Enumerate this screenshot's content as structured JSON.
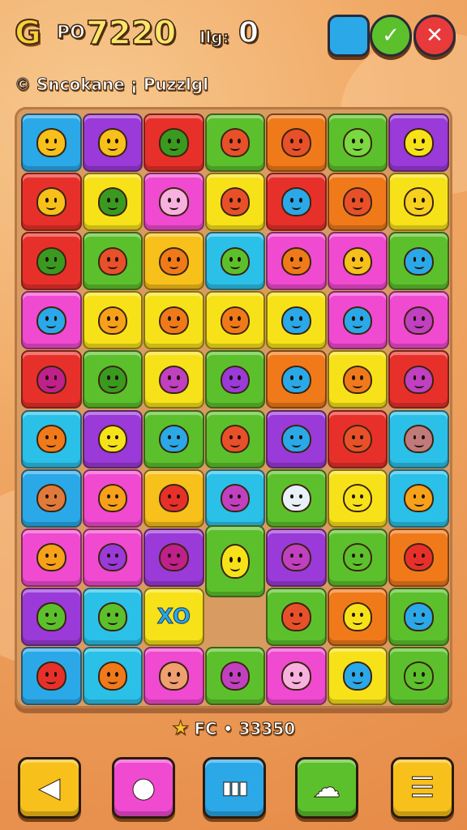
{
  "hud": {
    "logo": "G",
    "score_prefix": "PO",
    "score_value": "7220",
    "moves_label": "Ilg:",
    "moves_value": "0"
  },
  "top_buttons": [
    {
      "name": "menu-square-button",
      "color": "#2aa8e8",
      "shape": "square",
      "glyph": ""
    },
    {
      "name": "check-button",
      "color": "#5cc02c",
      "shape": "round",
      "glyph": "✓"
    },
    {
      "name": "close-button",
      "color": "#e83a3a",
      "shape": "round",
      "glyph": "✕"
    }
  ],
  "subtitle": "© Sncokane ¡ Puzzlgl",
  "board": {
    "rows": 10,
    "cols": 7,
    "colors": [
      [
        "#2aa8e8",
        "#9a3ad8",
        "#e8302a",
        "#5cc02c",
        "#f07a1a",
        "#5cc02c",
        "#9a3ad8"
      ],
      [
        "#e8302a",
        "#f7e21a",
        "#f04ad0",
        "#f7e21a",
        "#e8302a",
        "#f07a1a",
        "#f7e21a"
      ],
      [
        "#e8302a",
        "#5cc02c",
        "#f7c01a",
        "#2ac0e8",
        "#f04ad0",
        "#f04ad0",
        "#5cc02c"
      ],
      [
        "#f04ad0",
        "#f7e21a",
        "#f7e21a",
        "#f7e21a",
        "#f7e21a",
        "#f04ad0",
        "#f04ad0"
      ],
      [
        "#e8302a",
        "#5cc02c",
        "#f7e21a",
        "#5cc02c",
        "#f07a1a",
        "#f7e21a",
        "#e8302a"
      ],
      [
        "#2ac0e8",
        "#9a3ad8",
        "#5cc02c",
        "#5cc02c",
        "#9a3ad8",
        "#e8302a",
        "#2ac0e8"
      ],
      [
        "#2aa8e8",
        "#f04ad0",
        "#f7c01a",
        "#2ac0e8",
        "#5cc02c",
        "#f7e21a",
        "#2ac0e8"
      ],
      [
        "#f04ad0",
        "#f04ad0",
        "#9a3ad8",
        "#5cc02c",
        "#9a3ad8",
        "#5cc02c",
        "#f07a1a"
      ],
      [
        "#9a3ad8",
        "#2ac0e8",
        "#f7e21a",
        "",
        "#5cc02c",
        "#f07a1a",
        "#5cc02c"
      ],
      [
        "#2aa8e8",
        "#2ac0e8",
        "#f04ad0",
        "#5cc02c",
        "#f04ad0",
        "#f7e21a",
        "#5cc02c"
      ]
    ],
    "creature_colors": [
      [
        "#f7c01a",
        "#f7c01a",
        "#3a9a20",
        "#e8502a",
        "#e8502a",
        "#7ad840",
        "#f7e21a"
      ],
      [
        "#f7c01a",
        "#3a9a20",
        "#f8b0e0",
        "#e8502a",
        "#2aa8e8",
        "#e8502a",
        "#f7d020"
      ],
      [
        "#3a9a20",
        "#e8502a",
        "#f07a1a",
        "#5cc02c",
        "#f07a1a",
        "#f7c01a",
        "#2aa8e8"
      ],
      [
        "#2aa8e8",
        "#f7a01a",
        "#f07a1a",
        "#f07a1a",
        "#2aa8e8",
        "#2aa8e8",
        "#c040c0"
      ],
      [
        "#c0208a",
        "#3a9a20",
        "#c040c0",
        "#9a3ad8",
        "#2aa8e8",
        "#f07a1a",
        "#c040c0"
      ],
      [
        "#f07a1a",
        "#f7e21a",
        "#2aa8e8",
        "#e8502a",
        "#2aa8e8",
        "#e8502a",
        "#c07a7a"
      ],
      [
        "#e07a3a",
        "#f7a01a",
        "#e8302a",
        "#c040c0",
        "#e8f0f8",
        "#f7e21a",
        "#f7a01a"
      ],
      [
        "#f7a01a",
        "#9a3ad8",
        "#c0208a",
        "#f7e21a",
        "#c040c0",
        "#5cc02c",
        "#e8302a"
      ],
      [
        "#5cc02c",
        "#5cc02c",
        "#2aa8e8",
        "",
        "#e8502a",
        "#f7e21a",
        "#2aa8e8"
      ],
      [
        "#e8302a",
        "#f07a1a",
        "#f0a070",
        "#c040c0",
        "#f8b0e0",
        "#2aa8e8",
        "#5cc02c"
      ]
    ],
    "special_tile": {
      "text": "XO"
    }
  },
  "footer": {
    "score_label": "FC • 33350"
  },
  "bottom_buttons": [
    {
      "name": "back-button",
      "color": "#f7c01a",
      "glyph": "◀"
    },
    {
      "name": "chat-button",
      "color": "#f04ad0",
      "glyph": "●"
    },
    {
      "name": "stats-button",
      "color": "#2aa8e8",
      "glyph": "▮▮▮"
    },
    {
      "name": "cloud-button",
      "color": "#5cc02c",
      "glyph": "☁"
    },
    {
      "name": "menu-button",
      "color": "#f7c01a",
      "glyph": "☰"
    }
  ]
}
